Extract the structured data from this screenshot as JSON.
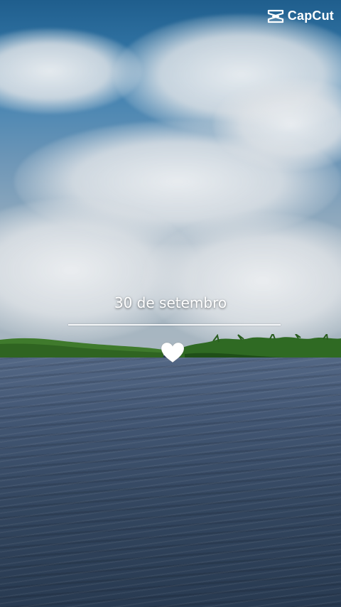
{
  "watermark": {
    "brand": "CapCut",
    "icon": "capcut-logo-icon"
  },
  "overlay": {
    "date_text": "30 de setembro",
    "heart_icon": "heart-icon",
    "heart_color": "#ffffff"
  },
  "scene": {
    "sky_color": "#3b7fb0",
    "sea_color": "#33465f",
    "vegetation_color": "#3f7a2c"
  }
}
